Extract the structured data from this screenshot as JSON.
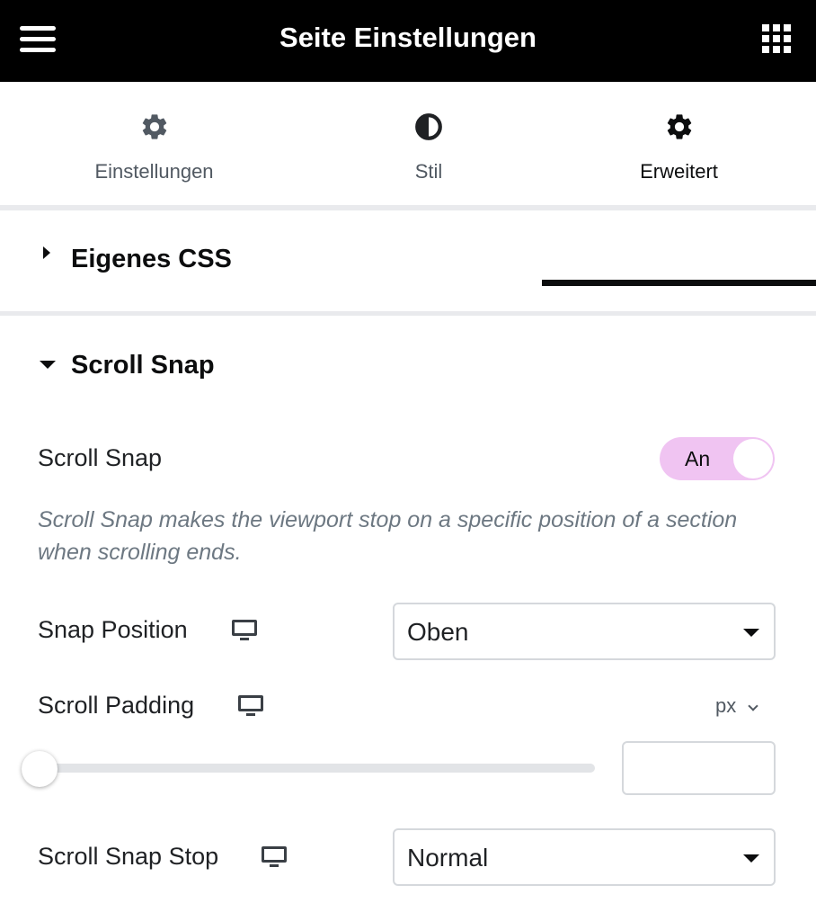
{
  "header": {
    "title": "Seite Einstellungen",
    "menu_icon": "hamburger-menu-icon",
    "apps_icon": "grid-apps-icon"
  },
  "tabs": [
    {
      "label": "Einstellungen",
      "icon": "gear-icon",
      "active": false
    },
    {
      "label": "Stil",
      "icon": "half-circle-contrast-icon",
      "active": false
    },
    {
      "label": "Erweitert",
      "icon": "gear-icon",
      "active": true
    }
  ],
  "sections": {
    "custom_css": {
      "title": "Eigenes CSS",
      "expanded": false
    },
    "scroll_snap": {
      "title": "Scroll Snap",
      "expanded": true
    }
  },
  "controls": {
    "scroll_snap": {
      "label": "Scroll Snap",
      "toggle_label": "An",
      "toggle_on": true,
      "description": "Scroll Snap makes the viewport stop on a specific position of a section when scrolling ends."
    },
    "snap_position": {
      "label": "Snap Position",
      "device_icon": "desktop-monitor-icon",
      "value": "Oben"
    },
    "scroll_padding": {
      "label": "Scroll Padding",
      "device_icon": "desktop-monitor-icon",
      "unit": "px",
      "slider_value": 0,
      "input_value": ""
    },
    "scroll_snap_stop": {
      "label": "Scroll Snap Stop",
      "device_icon": "desktop-monitor-icon",
      "value": "Normal"
    }
  },
  "colors": {
    "header_bg": "#000000",
    "toggle_bg": "#f0c4f2",
    "active_tab": "#0c0d0e",
    "description_text": "#6d7882"
  }
}
